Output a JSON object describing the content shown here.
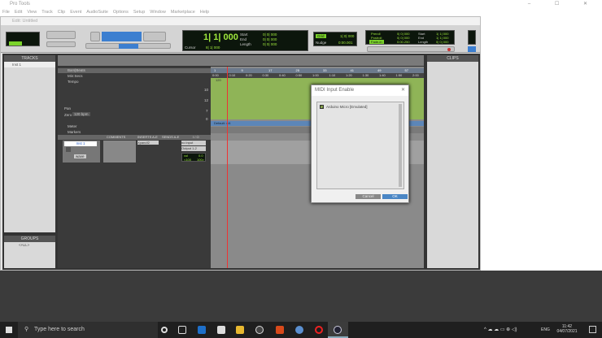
{
  "app": {
    "title": "Pro Tools",
    "window_controls": "– ☐ ✕"
  },
  "menu": [
    "File",
    "Edit",
    "View",
    "Track",
    "Clip",
    "Event",
    "AudioSuite",
    "Options",
    "Setup",
    "Window",
    "Marketplace",
    "Help"
  ],
  "edit_window": {
    "title": "Edit: Untitled"
  },
  "counters": {
    "main": "1| 1| 000",
    "cursor_label": "Cursor",
    "cursor_value": "8| 1| 000",
    "start_label": "Start",
    "end_label": "End",
    "length_label": "Length",
    "start": "0| 0| 000",
    "end": "0| 0| 000",
    "length": "0| 0| 000",
    "grid_value": "1| 0| 000",
    "nudge_label": "Nudge",
    "nudge_value": "0:00.001",
    "preroll": "Preroll",
    "postroll": "Postroll",
    "fade_in": "Fade-in",
    "pre_val": "0| 0| 000",
    "post_val": "0| 0| 000",
    "fade_val": "0:00.250",
    "t_start": "1| 1| 000",
    "t_end": "1| 1| 000",
    "t_length": "0| 0| 000"
  },
  "tracks_panel": {
    "title": "TRACKS",
    "items": [
      "Inst 1"
    ]
  },
  "groups_panel": {
    "title": "GROUPS",
    "items": [
      "<ALL>"
    ]
  },
  "clips_panel": {
    "title": "CLIPS"
  },
  "rulers": {
    "bars_beats": "Bars|Beats",
    "min_secs": "Min:Secs",
    "tempo": "Tempo",
    "meter": "Meter",
    "markers": "Markers",
    "tempo_val_a": "10",
    "tempo_val_b": "12",
    "tempo_val_c": "7",
    "tempo_val_d": "0",
    "pan_label": "Pan",
    "zero_label": "Zero",
    "zero_val": "120 bpm",
    "bar_ticks": [
      "1",
      "9",
      "17",
      "25",
      "33",
      "41",
      "49",
      "57"
    ],
    "time_ticks": [
      "0:00",
      "0:10",
      "0:20",
      "0:30",
      "0:40",
      "0:50",
      "1:00",
      "1:10",
      "1:20",
      "1:30",
      "1:40",
      "1:50",
      "2:00"
    ],
    "tempo_marker": "120",
    "meter_marker": "Default: 4/4"
  },
  "mix_header": {
    "comments": "COMMENTS",
    "inserts": "INSERTS A-E",
    "sends": "SENDS A-E",
    "io": "I / O"
  },
  "track": {
    "name": "Inst 1",
    "insert": "Xpand!2",
    "input": "no input",
    "output": "Output 1-2",
    "vol_label": "vol",
    "vol_value": "0.0",
    "pan_l": "<100",
    "pan_r": "100>",
    "mode": "wave"
  },
  "dialog": {
    "title": "MIDI Input Enable",
    "close": "✕",
    "device": "Arduino Micro [Emulated]",
    "checked": true,
    "cancel": "Cancel",
    "ok": "OK"
  },
  "taskbar": {
    "search_placeholder": "Type here to search",
    "lang": "ENG",
    "time": "11:42",
    "date": "04/07/2021"
  }
}
